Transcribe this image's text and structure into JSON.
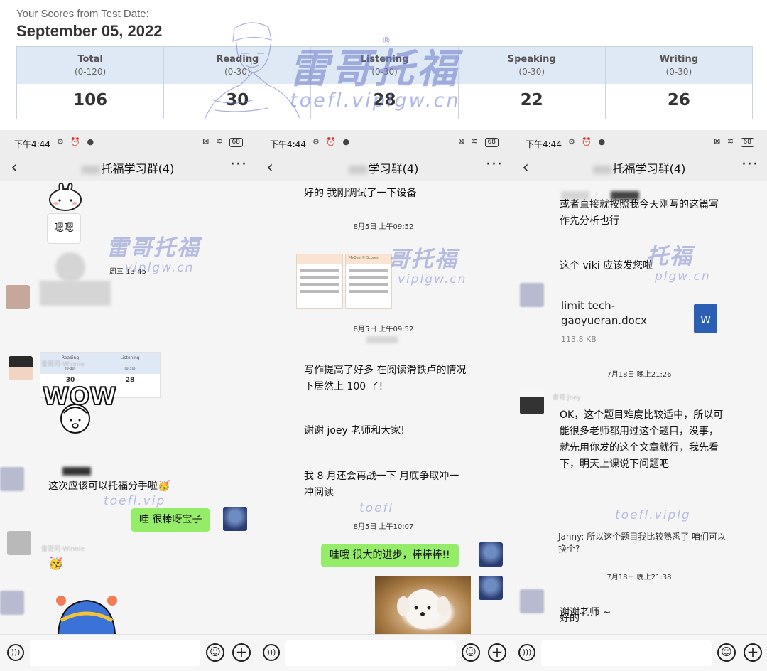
{
  "report": {
    "caption": "Your Scores from Test Date:",
    "date": "September 05, 2022",
    "scores": [
      {
        "name": "Total",
        "range": "(0-120)",
        "value": "106"
      },
      {
        "name": "Reading",
        "range": "(0-30)",
        "value": "30"
      },
      {
        "name": "Listening",
        "range": "(0-30)",
        "value": "28"
      },
      {
        "name": "Speaking",
        "range": "(0-30)",
        "value": "22"
      },
      {
        "name": "Writing",
        "range": "(0-30)",
        "value": "26"
      }
    ],
    "watermark_brand": "雷哥托福",
    "watermark_reg": "®",
    "watermark_url": "toefl.viplgw.cn"
  },
  "status": {
    "time": "下午4:44",
    "left_icons": "⚙ ⏰ ●",
    "right_icons": "⊠ ≋",
    "battery": "68"
  },
  "phones": [
    {
      "title": "托福学习群(4)",
      "sticker_caption": "嗯嗯",
      "timestamp": "周三 13:45",
      "mini_scores": {
        "headers": [
          "Reading",
          "Listening"
        ],
        "ranges": [
          "(0-30)",
          "(0-30)"
        ],
        "values": [
          "30",
          "28"
        ]
      },
      "sender_name": "雷哥同-Winnie",
      "sticker_text": "WOW",
      "message": "这次应该可以托福分手啦🥳",
      "reply": "哇 很棒呀宝子",
      "sender_name_2": "雷哥同-Winnie",
      "reaction": "🥳",
      "watermark_brand": "雷哥托福",
      "watermark_url": "viplgw.cn",
      "watermark_url_2": "toefl.vip"
    },
    {
      "title": "学习群(4)",
      "msg_top": "好的 我刚调试了一下设备",
      "timestamp_1": "8月5日 上午09:52",
      "timestamp_2": "8月5日 上午09:52",
      "msg_1": "写作提高了好多 在阅读滑铁卢的情况下居然上 100 了!",
      "msg_2": "谢谢 joey 老师和大家!",
      "msg_3": "我 8 月还会再战一下 月底争取冲一冲阅读",
      "timestamp_3": "8月5日 上午10:07",
      "reply": "哇哦 很大的进步，棒棒棒!!",
      "card_title": "MyBest® Scores",
      "watermark_brand": "哥托福",
      "watermark_url": "viplgw.cn",
      "watermark_url_2": "toefl"
    },
    {
      "title": "托福学习群(4)",
      "msg_top": "或者直接就按照我今天刚写的这篇写作先分析也行",
      "msg_1": "这个 viki 应该发您啦",
      "file_name": "limit tech- gaoyueran.docx",
      "file_size": "113.8 KB",
      "file_icon": "W",
      "timestamp_1": "7月18日 晚上21:26",
      "sender_name": "雷哥 Joey",
      "msg_2": "OK，这个题目难度比较适中，所以可能很多老师都用过这个题目，没事，就先用你发的这个文章就行，我先看下，明天上课说下问题吧",
      "quote": "Janny: 所以这个题目我比较熟悉了 咱们可以换个?",
      "timestamp_2": "7月18日 晚上21:38",
      "msg_3": "好的",
      "msg_4": "谢谢老师 ~",
      "watermark_brand": "托福",
      "watermark_url": "plgw.cn",
      "watermark_url_2": "toefl.viplg"
    }
  ]
}
